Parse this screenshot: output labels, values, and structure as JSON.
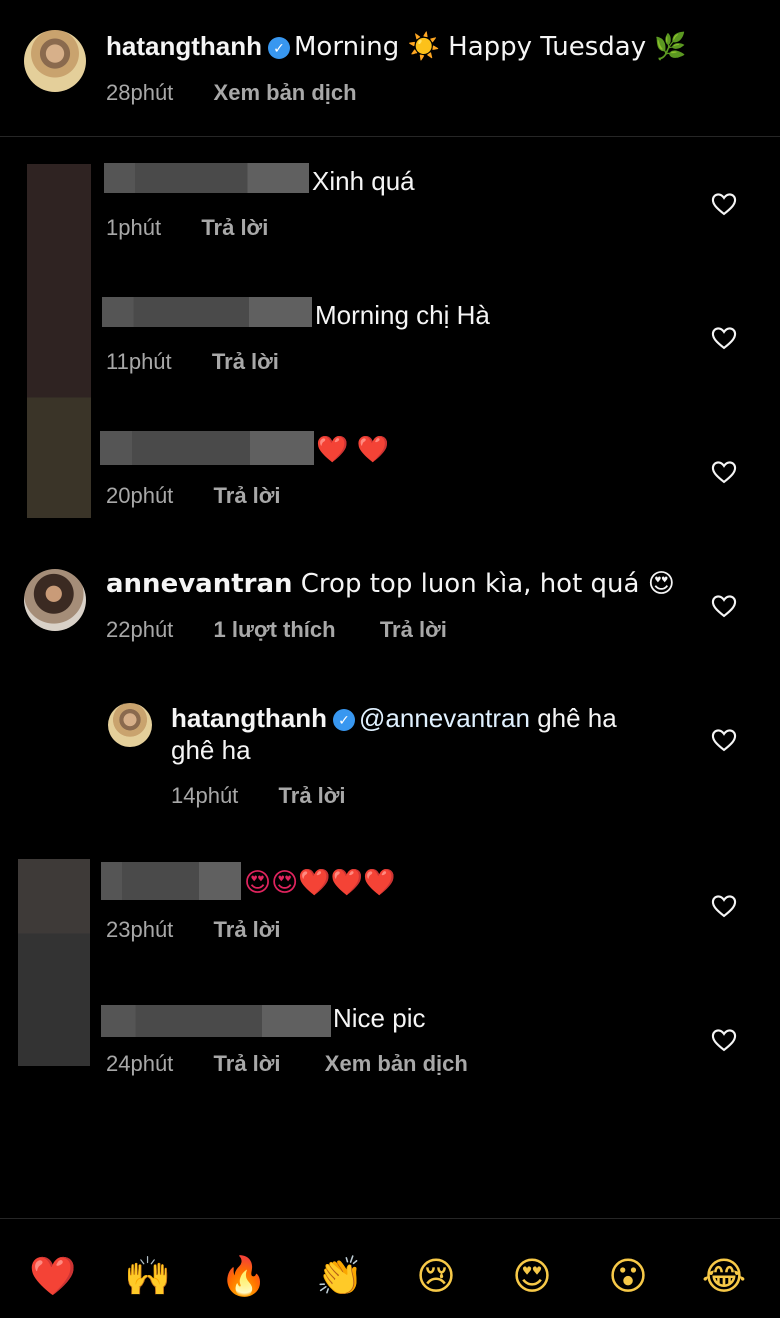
{
  "caption": {
    "username": "hatangthanh",
    "text": "Morning ☀️ Happy Tuesday 🌿",
    "time": "28phút",
    "translate": "Xem bản dịch"
  },
  "comments": [
    {
      "username": "",
      "text": "Xinh quá",
      "time": "1phút",
      "reply": "Trả lời"
    },
    {
      "username": "",
      "text": "Morning chị Hà",
      "time": "11phút",
      "reply": "Trả lời"
    },
    {
      "username": "",
      "text": "❤️ ❤️",
      "time": "20phút",
      "reply": "Trả lời"
    },
    {
      "username": "annevantran",
      "text": "Crop top luon kìa, hot quá 😍",
      "time": "22phút",
      "likes": "1 lượt thích",
      "reply": "Trả lời"
    },
    {
      "username": "hatangthanh",
      "mention": "@annevantran",
      "text_line1": " ghê ha",
      "text_line2": "ghê ha",
      "time": "14phút",
      "reply": "Trả lời"
    },
    {
      "username": "",
      "text": "😍😍❤️❤️❤️",
      "time": "23phút",
      "reply": "Trả lời"
    },
    {
      "username": "",
      "text": "Nice pic",
      "time": "24phút",
      "reply": "Trả lời",
      "translate": "Xem bản dịch"
    }
  ],
  "reaction_bar": [
    "❤️",
    "🙌",
    "🔥",
    "👏",
    "😢",
    "😍",
    "😮",
    "😂"
  ],
  "icons": {
    "like": "heart-outline-icon",
    "verified": "verified-badge-icon"
  },
  "colors": {
    "background": "#000000",
    "verified": "#3897f0",
    "secondary_text": "#a8a8a8",
    "mention": "#e0f1ff"
  }
}
